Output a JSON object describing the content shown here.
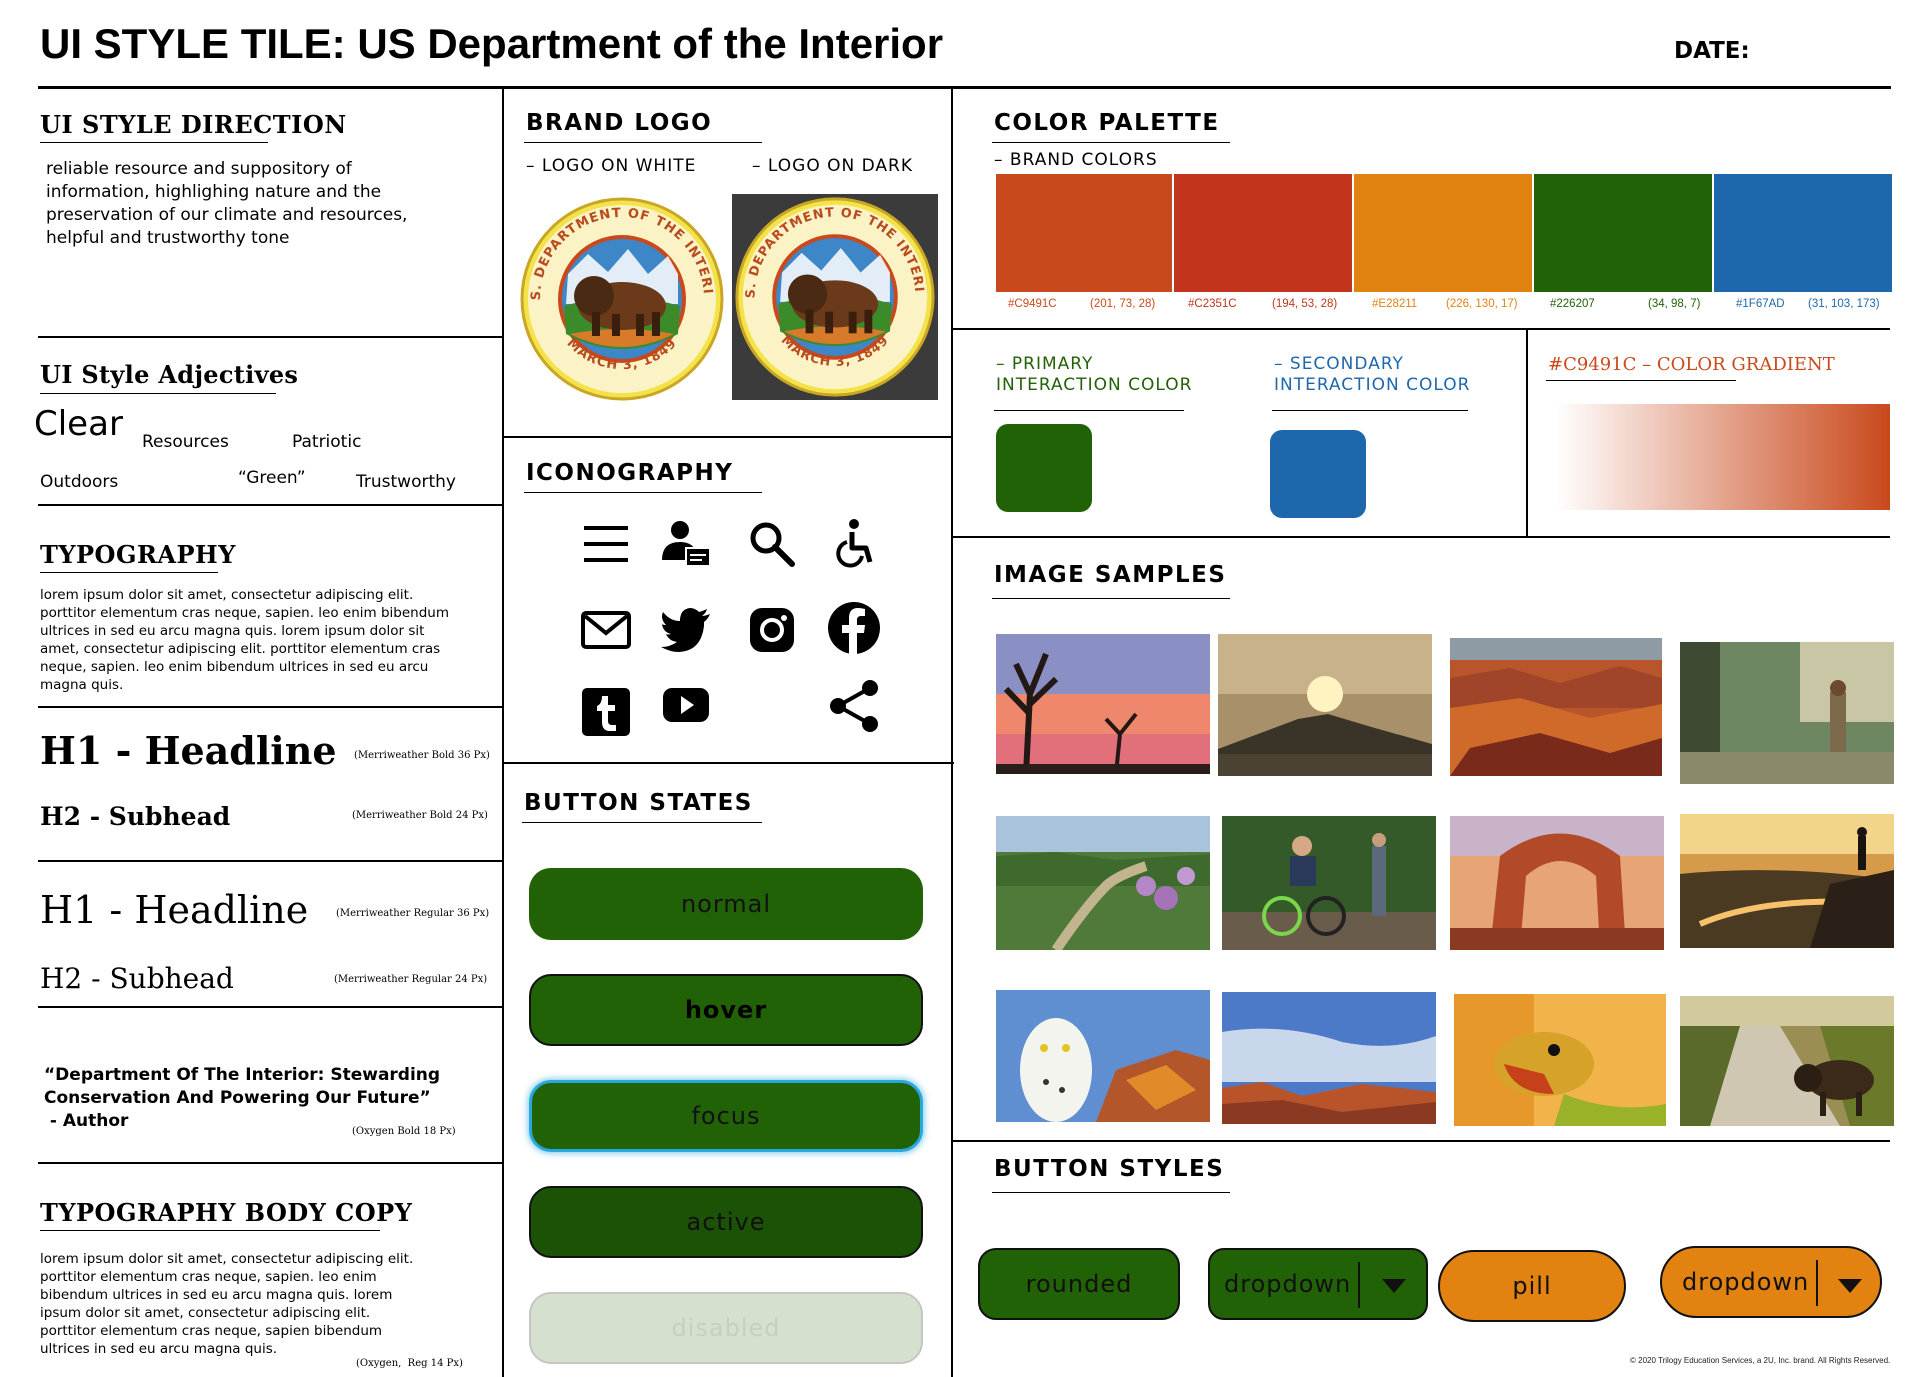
{
  "header": {
    "title": "UI STYLE TILE: US Department of the Interior",
    "date_label": "DATE:"
  },
  "style_direction": {
    "title": "UI STYLE DIRECTION",
    "lines": [
      "reliable resource and suppository of",
      "information, highlighing nature and the",
      "preservation of our climate and resources,",
      "helpful and trustworthy tone"
    ]
  },
  "adjectives": {
    "title": "UI Style Adjectives",
    "words": [
      "Clear",
      "Resources",
      "Patriotic",
      "Outdoors",
      "“Green”",
      "Trustworthy"
    ]
  },
  "typography": {
    "title": "TYPOGRAPHY",
    "sample_lines": [
      "lorem ipsum dolor sit amet, consectetur adipiscing elit.",
      "porttitor elementum cras neque, sapien. leo enim bibendum",
      "ultrices in sed eu arcu magna quis. lorem ipsum dolor sit",
      "amet, consectetur adipiscing elit. porttitor elementum cras",
      "neque, sapien. leo enim bibendum ultrices in sed eu arcu",
      "magna quis."
    ],
    "h1_bold": "H1 - Headline",
    "h1_bold_note": "(Merriweather Bold 36 Px)",
    "h2_bold": "H2 - Subhead",
    "h2_bold_note": "(Merriweather Bold 24 Px)",
    "h1_reg": "H1 - Headline",
    "h1_reg_note": "(Merriweather Regular 36 Px)",
    "h2_reg": "H2 - Subhead",
    "h2_reg_note": "(Merriweather Regular 24 Px)",
    "quote_lines": [
      "“Department Of The Interior: Stewarding",
      "Conservation And Powering Our Future”",
      " - Author"
    ],
    "quote_note": "(Oxygen Bold 18 Px)"
  },
  "body_copy": {
    "title": "TYPOGRAPHY BODY COPY",
    "lines": [
      "lorem ipsum dolor sit amet, consectetur adipiscing elit.",
      "porttitor elementum cras neque, sapien. leo enim",
      "bibendum ultrices in sed eu arcu magna quis. lorem",
      "ipsum dolor sit amet, consectetur adipiscing elit.",
      "porttitor elementum cras neque, sapien bibendum",
      "ultrices in sed eu arcu magna quis."
    ],
    "note": "(Oxygen,  Reg 14 Px)"
  },
  "brand_logo": {
    "title": "BRAND LOGO",
    "on_white": "– LOGO ON WHITE",
    "on_dark": "– LOGO ON DARK",
    "seal_top": "U.S. DEPARTMENT OF THE INTERIOR",
    "seal_bottom": "MARCH 3, 1849"
  },
  "iconography": {
    "title": "ICONOGRAPHY",
    "icons": [
      "menu-icon",
      "user-id-icon",
      "search-icon",
      "accessibility-icon",
      "mail-icon",
      "twitter-icon",
      "instagram-icon",
      "facebook-icon",
      "tumblr-icon",
      "youtube-icon",
      "share-icon"
    ]
  },
  "button_states": {
    "title": "BUTTON STATES",
    "normal": "normal",
    "hover": "hover",
    "focus": "focus",
    "active": "active",
    "disabled": "disabled"
  },
  "color_palette": {
    "title": "COLOR PALETTE",
    "brand_label": "– BRAND COLORS",
    "colors": [
      {
        "hex": "#C9491C",
        "rgb": "(201, 73, 28)"
      },
      {
        "hex": "#C2351C",
        "rgb": "(194, 53, 28)"
      },
      {
        "hex": "#E28211",
        "rgb": "(226, 130, 17)"
      },
      {
        "hex": "#226207",
        "rgb": "(34, 98, 7)"
      },
      {
        "hex": "#1F67AD",
        "rgb": "(31, 103, 173)"
      }
    ],
    "primary_label_1": "– PRIMARY",
    "primary_label_2": "INTERACTION COLOR",
    "primary_color": "#226207",
    "secondary_label_1": "– SECONDARY",
    "secondary_label_2": "INTERACTION COLOR",
    "secondary_color": "#1F67AD",
    "gradient_label": "#C9491C – COLOR GRADIENT",
    "gradient_color": "#C9491C"
  },
  "image_samples": {
    "title": "IMAGE SAMPLES",
    "images": [
      "joshua-tree-sunset",
      "mountain-sunset-clouds",
      "red-canyon",
      "hiker-in-forest",
      "river-valley-flowers",
      "adaptive-cyclist-trail",
      "arch-rock-formation",
      "hiker-river-sunset",
      "snowy-owl",
      "desert-canyon-sky",
      "collared-lizard",
      "bison-on-road"
    ]
  },
  "button_styles": {
    "title": "BUTTON STYLES",
    "rounded": "rounded",
    "dropdown_1": "dropdown",
    "pill": "pill",
    "dropdown_2": "dropdown"
  },
  "footer": {
    "copyright": "© 2020 Trilogy Education Services, a 2U, Inc. brand. All Rights Reserved."
  }
}
